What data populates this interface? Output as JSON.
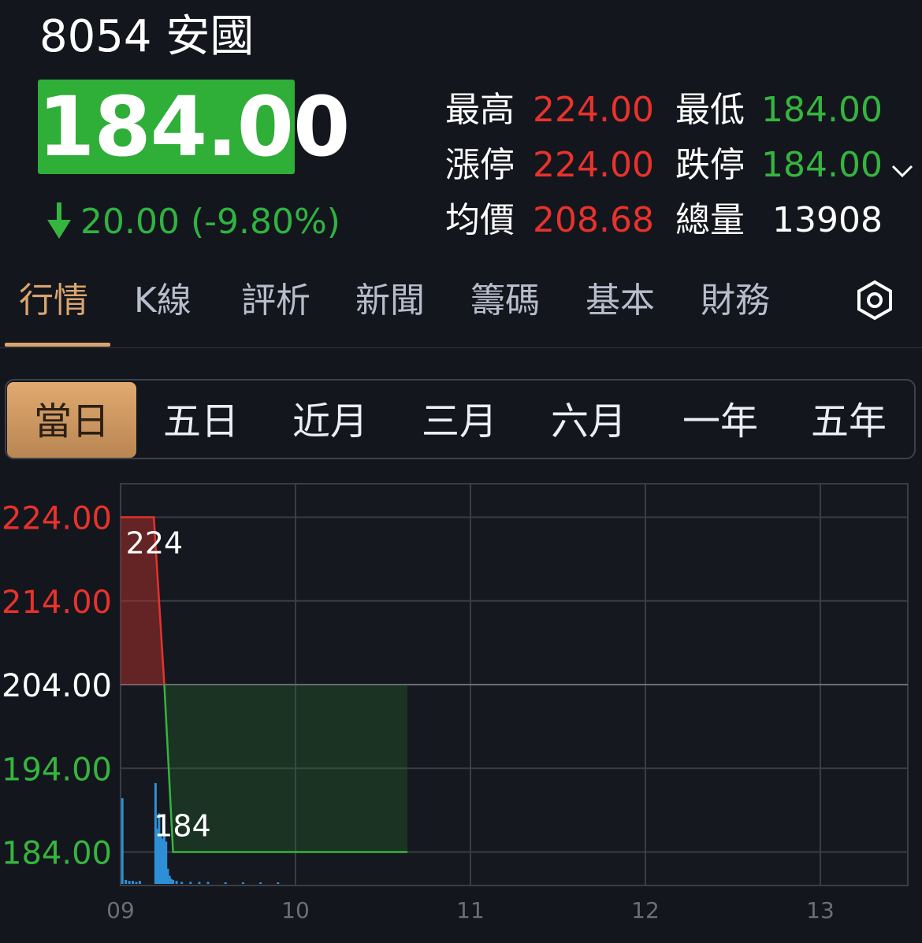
{
  "header": {
    "title": "8054 安國"
  },
  "quote": {
    "price": "184.00",
    "change": "20.00 (-9.80%)",
    "stats": [
      {
        "label": "最高",
        "value": "224.00",
        "color": "red"
      },
      {
        "label": "最低",
        "value": "184.00",
        "color": "green"
      },
      {
        "label": "漲停",
        "value": "224.00",
        "color": "red"
      },
      {
        "label": "跌停",
        "value": "184.00",
        "color": "green"
      },
      {
        "label": "均價",
        "value": "208.68",
        "color": "red"
      },
      {
        "label": "總量",
        "value": "13908",
        "color": "white"
      }
    ]
  },
  "tabs": [
    "行情",
    "K線",
    "評析",
    "新聞",
    "籌碼",
    "基本",
    "財務"
  ],
  "ranges": [
    "當日",
    "五日",
    "近月",
    "三月",
    "六月",
    "一年",
    "五年"
  ],
  "colors": {
    "accent": "#d9a56f",
    "up": "#e8322c",
    "down": "#35b53f",
    "volume": "#2f8fd6",
    "background": "#14161d"
  },
  "chart_data": {
    "type": "line",
    "reference_price": 204.0,
    "ylim": [
      180.0,
      228.0
    ],
    "ytick_labels": [
      "224.00",
      "214.00",
      "204.00",
      "194.00",
      "184.00"
    ],
    "yticks": [
      224.0,
      214.0,
      204.0,
      194.0,
      184.0
    ],
    "xtick_labels": [
      "09",
      "10",
      "11",
      "12",
      "13"
    ],
    "x_hours": [
      9,
      10,
      11,
      12,
      13
    ],
    "x_range_hours": [
      9.0,
      13.5
    ],
    "grid": true,
    "series": [
      {
        "x_hours": [
          9.0,
          9.19,
          9.25,
          9.3,
          10.64
        ],
        "price": [
          224.0,
          224.0,
          204.0,
          184.0,
          184.0
        ]
      }
    ],
    "annotations": [
      {
        "text": "224",
        "x_hours": 9.03,
        "price": 224.0
      },
      {
        "text": "184",
        "x_hours": 9.19,
        "price": 184.0
      }
    ],
    "volume": {
      "x_hours": [
        9.01,
        9.03,
        9.05,
        9.07,
        9.09,
        9.11,
        9.2,
        9.21,
        9.22,
        9.23,
        9.24,
        9.25,
        9.26,
        9.27,
        9.28,
        9.29,
        9.3,
        9.32,
        9.35,
        9.4,
        9.45,
        9.5,
        9.6,
        9.7,
        9.8,
        9.9
      ],
      "relative": [
        0.85,
        0.04,
        0.03,
        0.03,
        0.02,
        0.03,
        1.0,
        0.55,
        0.7,
        0.5,
        0.45,
        0.55,
        0.42,
        0.15,
        0.08,
        0.05,
        0.04,
        0.03,
        0.02,
        0.02,
        0.02,
        0.02,
        0.01,
        0.01,
        0.01,
        0.01
      ]
    }
  }
}
